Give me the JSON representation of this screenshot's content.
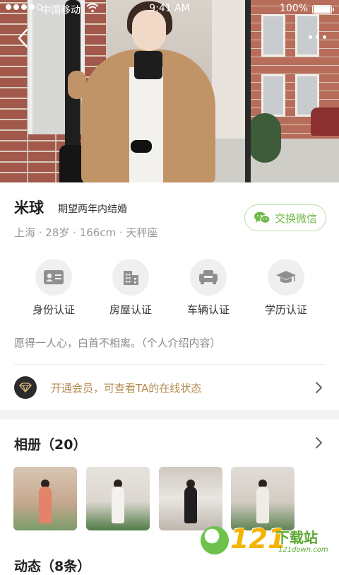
{
  "status_bar": {
    "carrier": "中国移动",
    "time": "9:41 AM",
    "battery": "100%"
  },
  "profile": {
    "name": "米球",
    "intent": "期望两年内结婚",
    "meta": "上海 · 28岁 · 166cm · 天秤座",
    "wechat_button": "交换微信",
    "bio": "愿得一人心，白首不相离。（个人介绍内容）"
  },
  "certifications": [
    {
      "label": "身份认证",
      "icon": "id-card-icon"
    },
    {
      "label": "房屋认证",
      "icon": "building-icon"
    },
    {
      "label": "车辆认证",
      "icon": "car-icon"
    },
    {
      "label": "学历认证",
      "icon": "graduation-cap-icon"
    }
  ],
  "vip": {
    "text": "开通会员，可查看TA的在线状态",
    "icon": "diamond-icon"
  },
  "album": {
    "title": "相册（20）"
  },
  "moments": {
    "title": "动态（8条）"
  },
  "watermark": {
    "number": "121",
    "name": "下载站",
    "url": "121down.com"
  },
  "colors": {
    "wechat_green": "#6fb84b",
    "vip_gold": "#b58a4c",
    "section_gap": "#f3f3f3"
  }
}
